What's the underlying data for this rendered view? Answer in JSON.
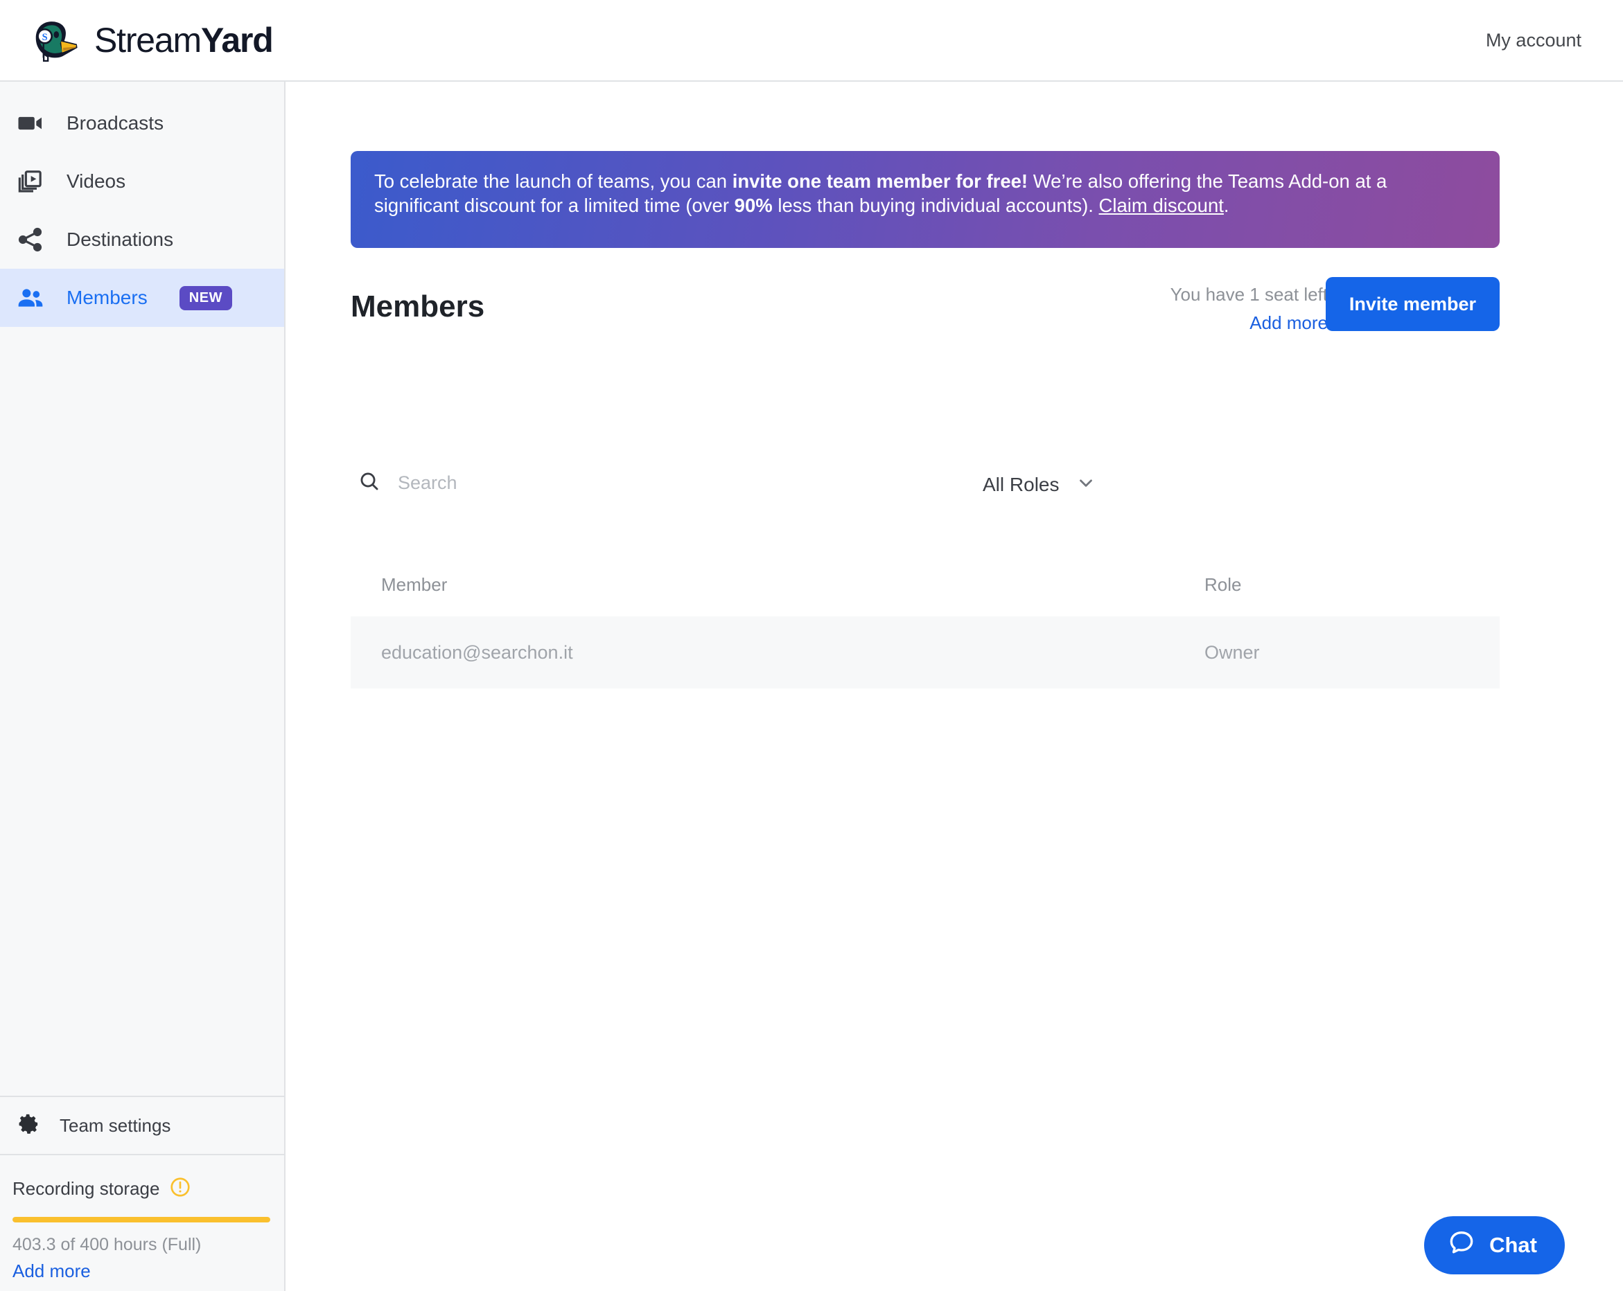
{
  "header": {
    "logo_name": "streamyard-duck-logo",
    "brand_light": "Stream",
    "brand_bold": "Yard",
    "my_account": "My account"
  },
  "sidebar": {
    "items": [
      {
        "label": "Broadcasts",
        "icon": "video-camera-icon",
        "active": false
      },
      {
        "label": "Videos",
        "icon": "video-library-icon",
        "active": false
      },
      {
        "label": "Destinations",
        "icon": "share-icon",
        "active": false
      },
      {
        "label": "Members",
        "icon": "people-icon",
        "active": true,
        "badge": "NEW"
      }
    ],
    "team_settings": {
      "label": "Team settings",
      "icon": "gear-icon"
    },
    "storage": {
      "title": "Recording storage",
      "warning_icon": "warning-exclamation-icon",
      "usage_text": "403.3 of 400 hours (Full)",
      "add_more": "Add more",
      "percent": 100,
      "bar_color": "#fac02e"
    }
  },
  "banner": {
    "part1": "To celebrate the launch of teams, you can ",
    "bold1": "invite one team member for free!",
    "part2": " We’re also offering the Teams Add-on at a significant discount for a limited time (over ",
    "bold2": "90%",
    "part3": " less than buying individual accounts). ",
    "link": "Claim discount",
    "part4": ".",
    "gradient_start": "#3b5bcc",
    "gradient_end": "#8e4c9e"
  },
  "page": {
    "title": "Members",
    "seats_text": "You have 1 seat left",
    "add_more": "Add more",
    "invite_button": "Invite member",
    "accent_color": "#1565e8"
  },
  "filters": {
    "search_placeholder": "Search",
    "search_value": "",
    "search_icon": "search-icon",
    "role_selected": "All Roles",
    "role_chevron": "chevron-down-icon"
  },
  "table": {
    "columns": [
      "Member",
      "Role"
    ],
    "rows": [
      {
        "member": "education@searchon.it",
        "role": "Owner"
      }
    ]
  },
  "chat": {
    "label": "Chat",
    "icon": "chat-bubble-icon"
  }
}
